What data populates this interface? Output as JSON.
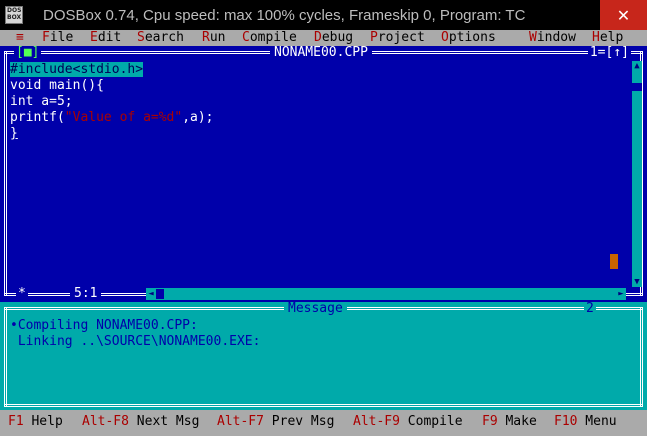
{
  "window": {
    "title": "DOSBox 0.74, Cpu speed: max 100% cycles, Frameskip  0, Program:    TC",
    "icon_label": "DOS BOX",
    "close_glyph": "✕"
  },
  "menu": {
    "system": "≡",
    "items": [
      {
        "hot": "F",
        "rest": "ile"
      },
      {
        "hot": "E",
        "rest": "dit"
      },
      {
        "hot": "S",
        "rest": "earch"
      },
      {
        "hot": "R",
        "rest": "un"
      },
      {
        "hot": "C",
        "rest": "ompile"
      },
      {
        "hot": "D",
        "rest": "ebug"
      },
      {
        "hot": "P",
        "rest": "roject"
      },
      {
        "hot": "O",
        "rest": "ptions"
      },
      {
        "hot": "W",
        "rest": "indow"
      },
      {
        "hot": "H",
        "rest": "elp"
      }
    ]
  },
  "editor": {
    "close_box": "[■]",
    "filename": "NONAME00.CPP",
    "window_number": "1=[↑]",
    "code": {
      "line1": "#include<stdio.h>",
      "line2": "void main(){",
      "line3": "int a=5;",
      "line4_pre": "printf(",
      "line4_str": "\"Value of a=%d\"",
      "line4_post": ",a);",
      "line5": "}"
    },
    "status_star": "*",
    "cursor_position": "5:1"
  },
  "message_window": {
    "title": "Message",
    "number": "2",
    "lines": [
      "•Compiling NONAME00.CPP:",
      " Linking ..\\SOURCE\\NONAME00.EXE:"
    ]
  },
  "statusbar": {
    "items": [
      {
        "key": "F1",
        "label": " Help"
      },
      {
        "key": "Alt-F8",
        "label": " Next Msg"
      },
      {
        "key": "Alt-F7",
        "label": " Prev Msg"
      },
      {
        "key": "Alt-F9",
        "label": " Compile"
      },
      {
        "key": "F9",
        "label": " Make"
      },
      {
        "key": "F10",
        "label": " Menu"
      }
    ]
  },
  "colors": {
    "editor_bg": "#0000aa",
    "menu_bg": "#aaaaaa",
    "message_bg": "#00aaaa",
    "hotkey": "#aa0000"
  }
}
